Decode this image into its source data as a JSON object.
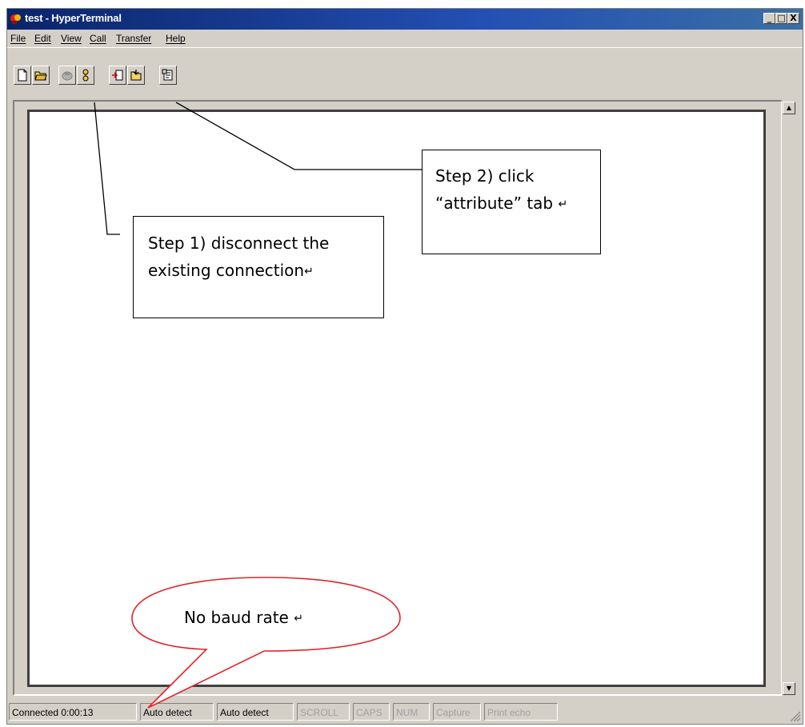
{
  "window": {
    "title": "test - HyperTerminal",
    "caption_buttons": [
      "_",
      "□",
      "X"
    ]
  },
  "menu": [
    "File",
    "Edit",
    "View",
    "Call",
    "Transfer",
    "Help"
  ],
  "toolbar_icons": [
    "new-icon",
    "open-icon",
    "call-icon",
    "disconnect-icon",
    "send-icon",
    "receive-icon",
    "properties-icon"
  ],
  "status": {
    "connected": "Connected 0:00:13",
    "detect1": "Auto detect",
    "detect2": "Auto detect",
    "scroll": "SCROLL",
    "caps": "CAPS",
    "num": "NUM",
    "capture": "Capture",
    "print_echo": "Print echo"
  },
  "annotations": {
    "step1_line1": "Step 1) disconnect the",
    "step1_line2": "existing connection",
    "step2_line1": "Step 2) click",
    "step2_line2": "“attribute” tab",
    "bubble": "No baud rate",
    "return_mark": "↵"
  },
  "colors": {
    "titlebar": "#0a246a",
    "chrome": "#d4d0c8",
    "bubble_outline": "#e0242a"
  }
}
